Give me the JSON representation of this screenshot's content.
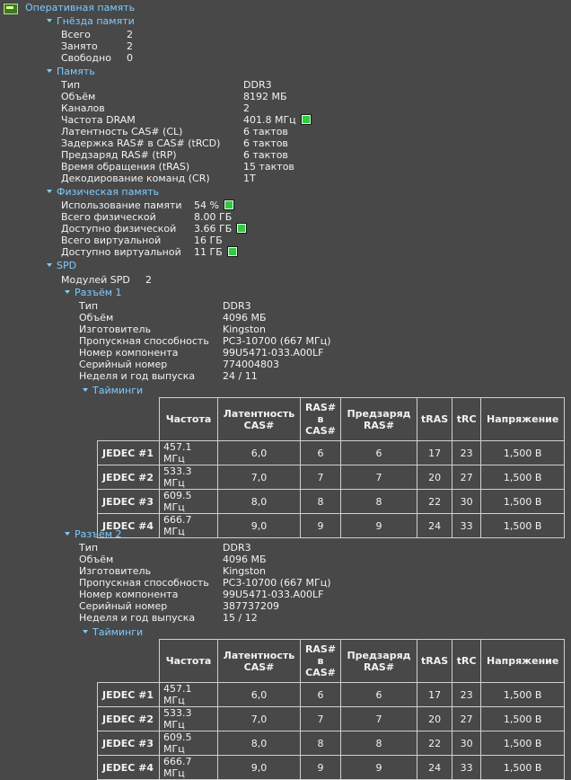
{
  "root": {
    "title": "Оперативная память"
  },
  "slots": {
    "title": "Гнёзда памяти",
    "rows": [
      {
        "k": "Всего",
        "v": "2"
      },
      {
        "k": "Занято",
        "v": "2"
      },
      {
        "k": "Свободно",
        "v": "0"
      }
    ]
  },
  "memory": {
    "title": "Память",
    "rows": [
      {
        "k": "Тип",
        "v": "DDR3"
      },
      {
        "k": "Объём",
        "v": "8192 МБ"
      },
      {
        "k": "Каналов",
        "v": "2"
      },
      {
        "k": "Частота DRAM",
        "v": "401.8 МГц"
      },
      {
        "k": "Латентность CAS# (CL)",
        "v": "6 тактов"
      },
      {
        "k": "Задержка RAS# в CAS# (tRCD)",
        "v": "6 тактов"
      },
      {
        "k": "Предзаряд RAS# (tRP)",
        "v": "6 тактов"
      },
      {
        "k": "Время обращения (tRAS)",
        "v": "15 тактов"
      },
      {
        "k": "Декодирование команд (CR)",
        "v": "1T"
      }
    ]
  },
  "physical": {
    "title": "Физическая память",
    "rows": [
      {
        "k": "Использование памяти",
        "v": "54 %"
      },
      {
        "k": "Всего физической",
        "v": "8.00 ГБ"
      },
      {
        "k": "Доступно физической",
        "v": "3.66 ГБ"
      },
      {
        "k": "Всего виртуальной",
        "v": "16 ГБ"
      },
      {
        "k": "Доступно виртуальной",
        "v": "11 ГБ"
      }
    ]
  },
  "spd": {
    "title": "SPD",
    "modules_label": "Модулей SPD",
    "modules_value": "2",
    "timings_title": "Тайминги",
    "columns": [
      "Частота",
      "Латентность CAS#",
      "RAS# в CAS#",
      "Предзаряд RAS#",
      "tRAS",
      "tRC",
      "Напряжение"
    ],
    "slots": [
      {
        "title": "Разъём 1",
        "rows": [
          {
            "k": "Тип",
            "v": "DDR3"
          },
          {
            "k": "Объём",
            "v": "4096 МБ"
          },
          {
            "k": "Изготовитель",
            "v": "Kingston"
          },
          {
            "k": "Пропускная способность",
            "v": "PC3-10700 (667 МГц)"
          },
          {
            "k": "Номер компонента",
            "v": "99U5471-033.A00LF"
          },
          {
            "k": "Серийный номер",
            "v": "774004803"
          },
          {
            "k": "Неделя и год выпуска",
            "v": "24 / 11"
          }
        ],
        "timings": [
          [
            "JEDEC #1",
            "457.1 МГц",
            "6,0",
            "6",
            "6",
            "17",
            "23",
            "1,500 В"
          ],
          [
            "JEDEC #2",
            "533.3 МГц",
            "7,0",
            "7",
            "7",
            "20",
            "27",
            "1,500 В"
          ],
          [
            "JEDEC #3",
            "609.5 МГц",
            "8,0",
            "8",
            "8",
            "22",
            "30",
            "1,500 В"
          ],
          [
            "JEDEC #4",
            "666.7 МГц",
            "9,0",
            "9",
            "9",
            "24",
            "33",
            "1,500 В"
          ]
        ]
      },
      {
        "title": "Разъём 2",
        "rows": [
          {
            "k": "Тип",
            "v": "DDR3"
          },
          {
            "k": "Объём",
            "v": "4096 МБ"
          },
          {
            "k": "Изготовитель",
            "v": "Kingston"
          },
          {
            "k": "Пропускная способность",
            "v": "PC3-10700 (667 МГц)"
          },
          {
            "k": "Номер компонента",
            "v": "99U5471-033.A00LF"
          },
          {
            "k": "Серийный номер",
            "v": "387737209"
          },
          {
            "k": "Неделя и год выпуска",
            "v": "15 / 12"
          }
        ],
        "timings": [
          [
            "JEDEC #1",
            "457.1 МГц",
            "6,0",
            "6",
            "6",
            "17",
            "23",
            "1,500 В"
          ],
          [
            "JEDEC #2",
            "533.3 МГц",
            "7,0",
            "7",
            "7",
            "20",
            "27",
            "1,500 В"
          ],
          [
            "JEDEC #3",
            "609.5 МГц",
            "8,0",
            "8",
            "8",
            "22",
            "30",
            "1,500 В"
          ],
          [
            "JEDEC #4",
            "666.7 МГц",
            "9,0",
            "9",
            "9",
            "24",
            "33",
            "1,500 В"
          ]
        ]
      }
    ]
  },
  "colors": {
    "background": "#484848",
    "heading": "#7ecbff",
    "indicator": "#2ecc40"
  },
  "icons": [
    "ram-icon",
    "chevron-down-icon",
    "status-indicator-icon"
  ]
}
